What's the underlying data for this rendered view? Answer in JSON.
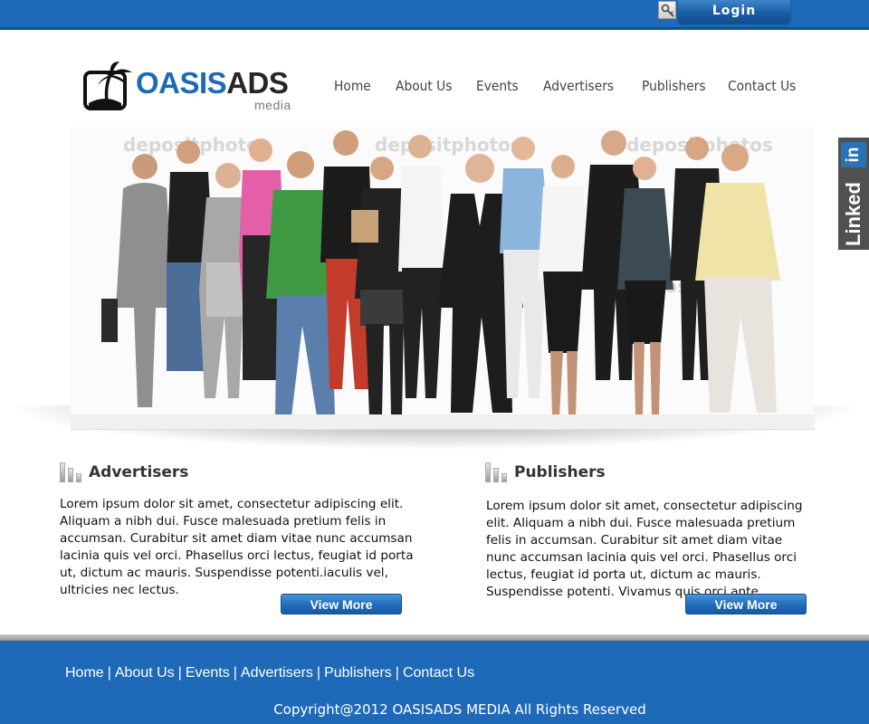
{
  "header": {
    "login_label": "Login",
    "icons": {
      "key": "key-icon"
    }
  },
  "logo": {
    "name_part1": "OASIS",
    "name_part2": "ADS",
    "subtitle": "media",
    "icon": "palm-tree-icon"
  },
  "nav": {
    "items": [
      "Home",
      "About Us",
      "Events",
      "Advertisers",
      "Publishers",
      "Contact Us"
    ]
  },
  "hero": {
    "watermark": "depositphotos",
    "image_icon": "group-of-people-photo"
  },
  "social": {
    "label": "Linked",
    "in_label": "in"
  },
  "sections": [
    {
      "title": "Advertisers",
      "body": "Lorem ipsum dolor sit amet, consectetur adipiscing elit. Aliquam a nibh dui. Fusce malesuada pretium felis in accumsan. Curabitur sit amet diam vitae nunc accumsan lacinia quis vel orci. Phasellus orci lectus, feugiat id porta ut, dictum ac mauris. Suspendisse potenti.iaculis vel, ultricies nec lectus.",
      "button_label": "View More"
    },
    {
      "title": "Publishers",
      "body": "Lorem ipsum dolor sit amet, consectetur adipiscing elit. Aliquam a nibh dui. Fusce malesuada pretium felis in accumsan. Curabitur sit amet diam vitae nunc accumsan lacinia quis vel orci. Phasellus orci lectus, feugiat id porta ut, dictum ac mauris. Suspendisse potenti. Vivamus quis orci ante.",
      "button_label": "View More"
    }
  ],
  "footer": {
    "nav": [
      "Home",
      "About Us",
      "Events",
      "Advertisers",
      "Publishers",
      "Contact Us"
    ],
    "separator": "|",
    "copyright": "Copyright@2012 OASISADS MEDIA All Rights Reserved"
  },
  "colors": {
    "brand_blue": "#1e6ab8",
    "text_dark": "#262626"
  }
}
